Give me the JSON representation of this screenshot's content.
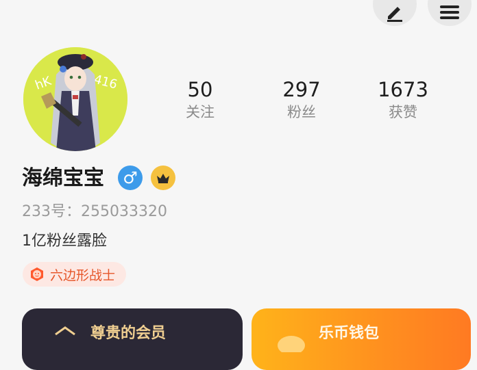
{
  "header": {
    "edit_icon": "edit-pencil-icon",
    "menu_icon": "hamburger-menu-icon"
  },
  "profile": {
    "nickname": "海绵宝宝",
    "gender_symbol": "♂",
    "uid": "233号：255033320",
    "bio": "1亿粉丝露脸",
    "tag": "六边形战士"
  },
  "stats": {
    "following": {
      "value": "50",
      "label": "关注"
    },
    "fans": {
      "value": "297",
      "label": "粉丝"
    },
    "likes": {
      "value": "1673",
      "label": "获赞"
    }
  },
  "cards": {
    "vip_title": "尊贵的会员",
    "wallet_title": "乐币钱包"
  },
  "colors": {
    "background": "#f6f6f6",
    "avatar_bg": "#d9e84a",
    "gender_badge": "#3d9bea",
    "vip_badge": "#f5c13f",
    "tag_bg": "#fde8e3",
    "tag_text": "#e6562a",
    "vip_card": "#2b2836",
    "wallet_card": "#ff9a1f"
  }
}
